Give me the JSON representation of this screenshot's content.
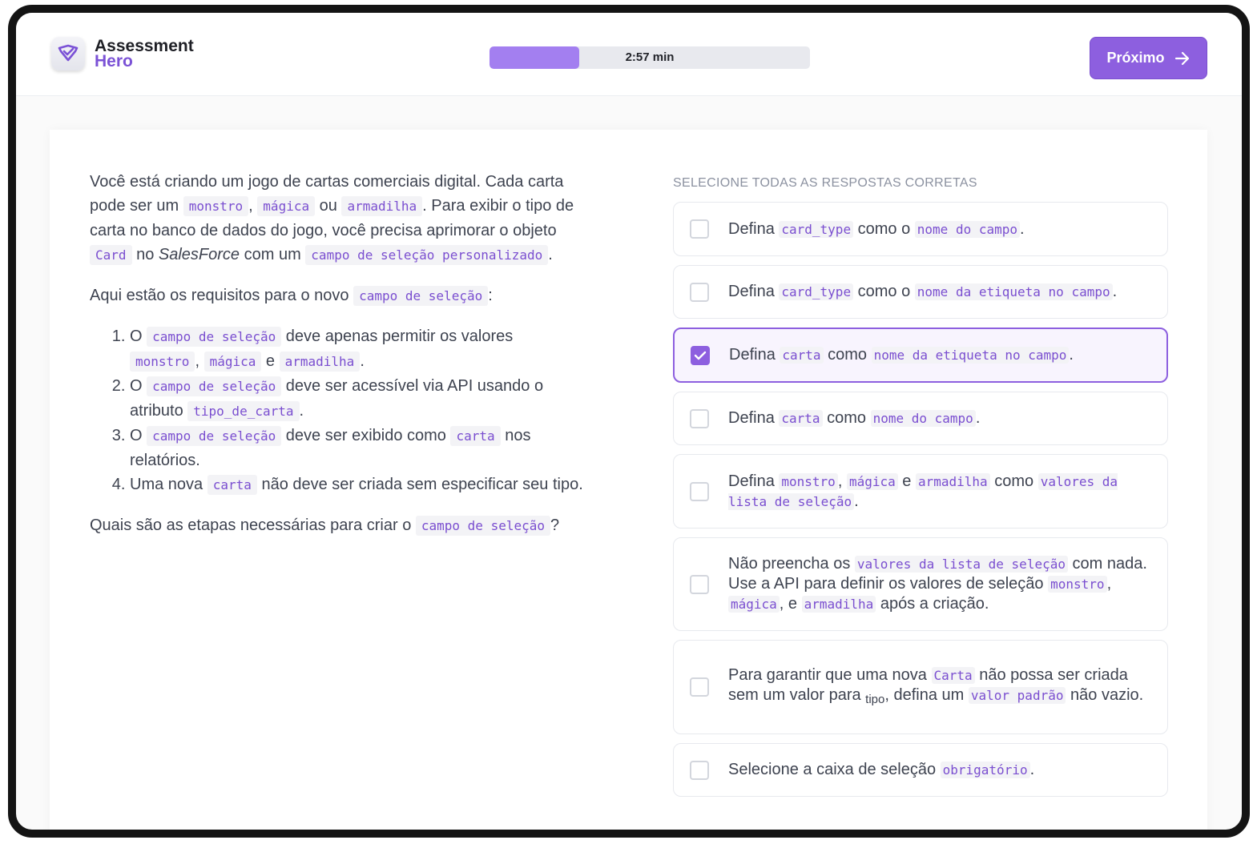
{
  "logo": {
    "line1": "Assessment",
    "line2": "Hero"
  },
  "timer": {
    "text": "2:57 min",
    "progress_percent": 28
  },
  "next_button": {
    "label": "Próximo"
  },
  "question": {
    "p1": {
      "a": "Você está criando um jogo de cartas comerciais digital. Cada carta pode ser um ",
      "c1": "monstro",
      "b": ", ",
      "c2": "mágica",
      "c": " ou ",
      "c3": "armadilha",
      "d": ". Para exibir o tipo de carta no banco de dados do jogo, você precisa aprimorar o objeto ",
      "c4": "Card",
      "e": " no ",
      "em": "SalesForce",
      "f": " com um ",
      "c5": "campo de seleção personalizado",
      "g": "."
    },
    "p2": {
      "a": "Aqui estão os requisitos para o novo ",
      "c1": "campo de seleção",
      "b": ":"
    },
    "reqs": [
      {
        "a": "O ",
        "c1": "campo de seleção",
        "b": " deve apenas permitir os valores ",
        "c2": "monstro",
        "c": ", ",
        "c3": "mágica",
        "d": " e ",
        "c4": "armadilha",
        "e": "."
      },
      {
        "a": "O ",
        "c1": "campo de seleção",
        "b": " deve ser acessível via API usando o atributo ",
        "c2": "tipo_de_carta",
        "c": "."
      },
      {
        "a": "O ",
        "c1": "campo de seleção",
        "b": " deve ser exibido como ",
        "c2": "carta",
        "c": " nos relatórios."
      },
      {
        "a": "Uma nova ",
        "c1": "carta",
        "b": " não deve ser criada sem especificar seu tipo."
      }
    ],
    "p3": {
      "a": "Quais são as etapas necessárias para criar o ",
      "c1": "campo de seleção",
      "b": "?"
    }
  },
  "answers": {
    "title": "SELECIONE TODAS AS RESPOSTAS CORRETAS",
    "options": [
      {
        "t1": "Defina ",
        "c1": "card_type",
        "t2": " como o ",
        "c2": "nome do campo",
        "t3": ".",
        "checked": false
      },
      {
        "t1": "Defina ",
        "c1": "card_type",
        "t2": " como o ",
        "c2": "nome da etiqueta no campo",
        "t3": ".",
        "checked": false
      },
      {
        "t1": "Defina ",
        "c1": "carta",
        "t2": " como ",
        "c2": "nome da etiqueta no campo",
        "t3": ".",
        "checked": true
      },
      {
        "t1": "Defina ",
        "c1": "carta",
        "t2": " como ",
        "c2": "nome do campo",
        "t3": ".",
        "checked": false
      },
      {
        "t1": "Defina ",
        "c1": "monstro",
        "t2": ", ",
        "c2": "mágica",
        "t3": " e ",
        "c3": "armadilha",
        "t4": " como ",
        "c4": "valores da lista de seleção",
        "t5": ".",
        "checked": false
      },
      {
        "t1": "Não preencha os ",
        "c1": "valores da lista de seleção",
        "t2": " com nada. Use a API para definir os valores de seleção ",
        "c2": "monstro",
        "t3": ", ",
        "c3": "mágica",
        "t4": ", e ",
        "c4": "armadilha",
        "t5": " após a criação.",
        "checked": false
      },
      {
        "t1": "Para garantir que uma nova ",
        "c1": "Carta",
        "t2": " não possa ser criada sem um valor para ",
        "s1": "tipo",
        "t3": ", defina um ",
        "c2": "valor padrão",
        "t4": " não vazio.",
        "checked": false
      },
      {
        "t1": "Selecione a caixa de seleção ",
        "c1": "obrigatório",
        "t2": ".",
        "checked": false
      }
    ]
  },
  "colors": {
    "accent": "#8d5fdf",
    "code": "#7a4ed0",
    "progress": "#a37ff0"
  },
  "icons": {
    "logo": "shield-check-icon",
    "next": "arrow-right-icon",
    "check": "check-icon"
  }
}
